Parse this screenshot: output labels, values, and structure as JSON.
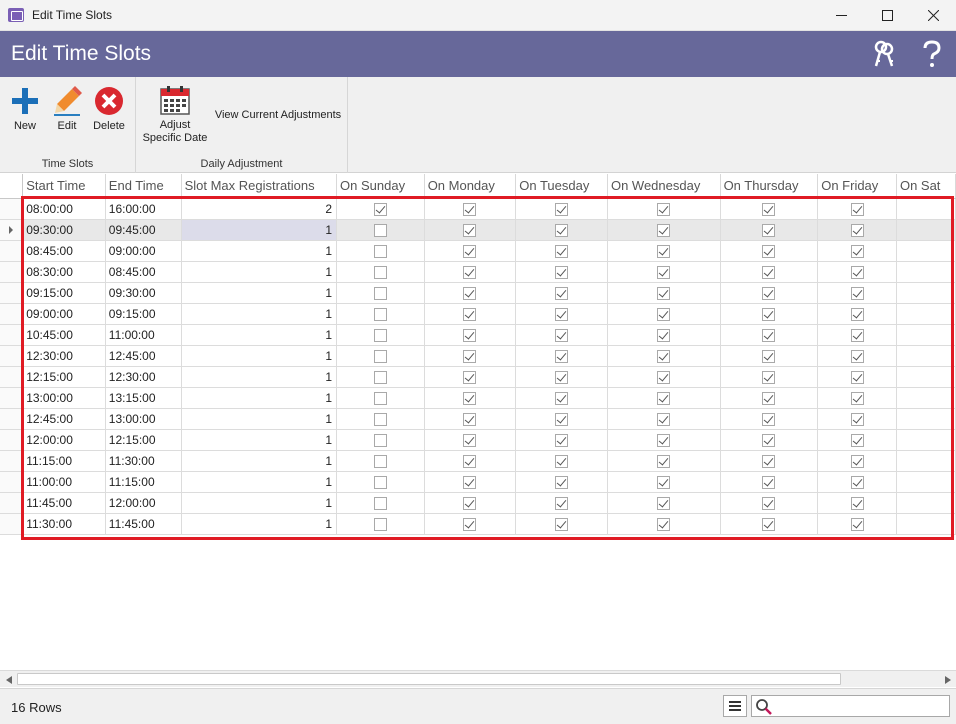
{
  "window": {
    "title": "Edit Time Slots"
  },
  "header": {
    "title": "Edit Time Slots"
  },
  "ribbon": {
    "groups": [
      {
        "label": "Time Slots",
        "buttons": [
          {
            "label": "New",
            "icon": "plus-icon"
          },
          {
            "label": "Edit",
            "icon": "pencil-icon"
          },
          {
            "label": "Delete",
            "icon": "delete-icon"
          }
        ]
      },
      {
        "label": "Daily Adjustment",
        "buttons": [
          {
            "label": "Adjust\nSpecific Date",
            "icon": "calendar-icon"
          },
          {
            "label": "View Current Adjustments"
          }
        ]
      }
    ]
  },
  "grid": {
    "columns": [
      "Start Time",
      "End Time",
      "Slot Max Registrations",
      "On Sunday",
      "On Monday",
      "On Tuesday",
      "On Wednesday",
      "On Thursday",
      "On Friday",
      "On Sat"
    ],
    "selected_row": 1,
    "rows": [
      {
        "start": "08:00:00",
        "end": "16:00:00",
        "max": "2",
        "days": [
          true,
          true,
          true,
          true,
          true,
          true
        ]
      },
      {
        "start": "09:30:00",
        "end": "09:45:00",
        "max": "1",
        "days": [
          false,
          true,
          true,
          true,
          true,
          true
        ]
      },
      {
        "start": "08:45:00",
        "end": "09:00:00",
        "max": "1",
        "days": [
          false,
          true,
          true,
          true,
          true,
          true
        ]
      },
      {
        "start": "08:30:00",
        "end": "08:45:00",
        "max": "1",
        "days": [
          false,
          true,
          true,
          true,
          true,
          true
        ]
      },
      {
        "start": "09:15:00",
        "end": "09:30:00",
        "max": "1",
        "days": [
          false,
          true,
          true,
          true,
          true,
          true
        ]
      },
      {
        "start": "09:00:00",
        "end": "09:15:00",
        "max": "1",
        "days": [
          false,
          true,
          true,
          true,
          true,
          true
        ]
      },
      {
        "start": "10:45:00",
        "end": "11:00:00",
        "max": "1",
        "days": [
          false,
          true,
          true,
          true,
          true,
          true
        ]
      },
      {
        "start": "12:30:00",
        "end": "12:45:00",
        "max": "1",
        "days": [
          false,
          true,
          true,
          true,
          true,
          true
        ]
      },
      {
        "start": "12:15:00",
        "end": "12:30:00",
        "max": "1",
        "days": [
          false,
          true,
          true,
          true,
          true,
          true
        ]
      },
      {
        "start": "13:00:00",
        "end": "13:15:00",
        "max": "1",
        "days": [
          false,
          true,
          true,
          true,
          true,
          true
        ]
      },
      {
        "start": "12:45:00",
        "end": "13:00:00",
        "max": "1",
        "days": [
          false,
          true,
          true,
          true,
          true,
          true
        ]
      },
      {
        "start": "12:00:00",
        "end": "12:15:00",
        "max": "1",
        "days": [
          false,
          true,
          true,
          true,
          true,
          true
        ]
      },
      {
        "start": "11:15:00",
        "end": "11:30:00",
        "max": "1",
        "days": [
          false,
          true,
          true,
          true,
          true,
          true
        ]
      },
      {
        "start": "11:00:00",
        "end": "11:15:00",
        "max": "1",
        "days": [
          false,
          true,
          true,
          true,
          true,
          true
        ]
      },
      {
        "start": "11:45:00",
        "end": "12:00:00",
        "max": "1",
        "days": [
          false,
          true,
          true,
          true,
          true,
          true
        ]
      },
      {
        "start": "11:30:00",
        "end": "11:45:00",
        "max": "1",
        "days": [
          false,
          true,
          true,
          true,
          true,
          true
        ]
      }
    ]
  },
  "status": {
    "row_count": "16 Rows",
    "search_placeholder": ""
  },
  "colors": {
    "header_bg": "#67689a",
    "highlight": "#e01b24",
    "plus": "#1b6fb8",
    "delete": "#d9282f"
  }
}
